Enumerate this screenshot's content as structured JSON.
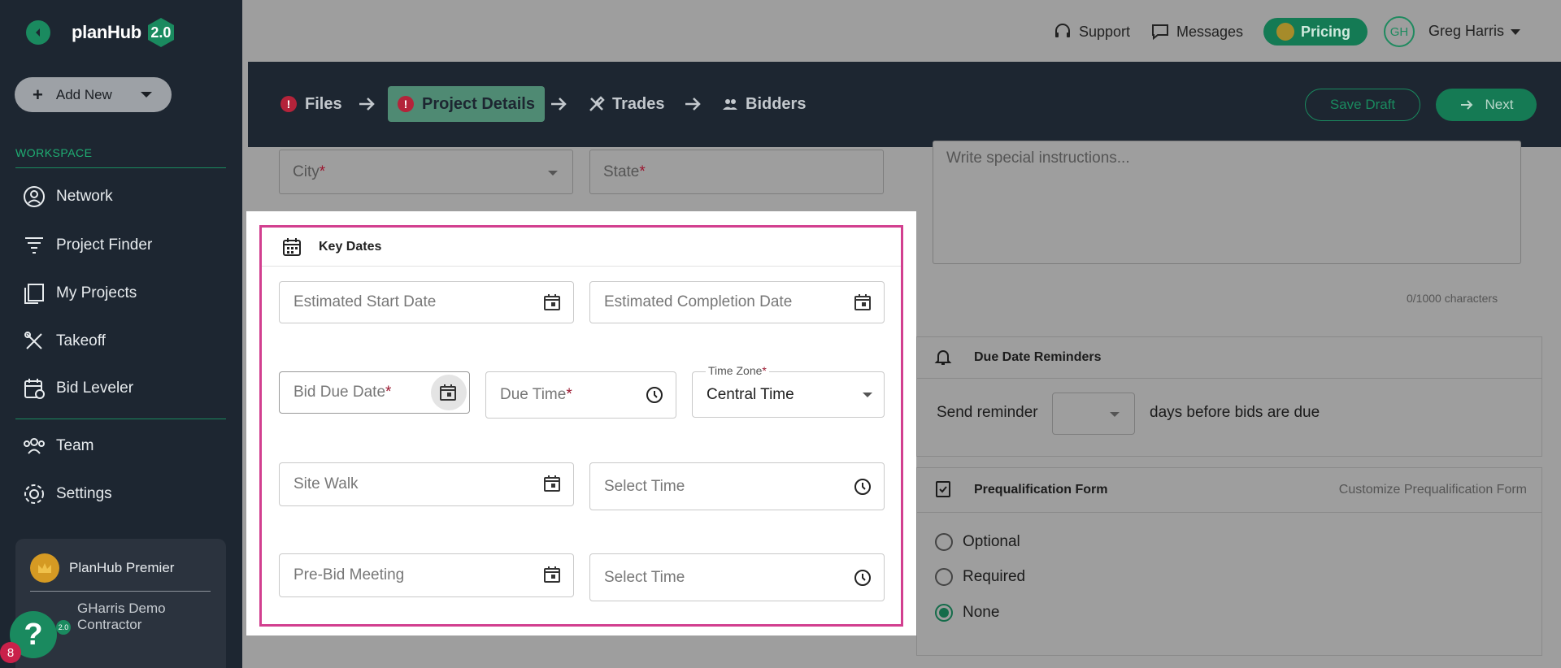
{
  "brand": {
    "name": "planHub",
    "version": "2.0"
  },
  "sidebar": {
    "add_new": "Add New",
    "workspace_label": "WORKSPACE",
    "items": [
      {
        "label": "Network",
        "icon": "user-circle-icon"
      },
      {
        "label": "Project Finder",
        "icon": "filter-icon"
      },
      {
        "label": "My Projects",
        "icon": "projects-icon"
      },
      {
        "label": "Takeoff",
        "icon": "takeoff-icon"
      },
      {
        "label": "Bid Leveler",
        "icon": "bid-leveler-icon"
      },
      {
        "label": "Team",
        "icon": "team-icon"
      },
      {
        "label": "Settings",
        "icon": "gear-icon"
      }
    ],
    "premier": {
      "label": "PlanHub Premier",
      "company": "GHarris Demo Contractor",
      "badge": "2.0"
    },
    "help_badge": "8"
  },
  "topbar": {
    "support": "Support",
    "messages": "Messages",
    "pricing": "Pricing",
    "avatar": "GH",
    "user": "Greg Harris"
  },
  "steps": [
    {
      "label": "Files",
      "warn": "!"
    },
    {
      "label": "Project Details",
      "warn": "!"
    },
    {
      "label": "Trades"
    },
    {
      "label": "Bidders"
    }
  ],
  "actions": {
    "save_draft": "Save Draft",
    "next": "Next"
  },
  "background_form": {
    "city": "City",
    "state": "State",
    "instructions_placeholder": "Write special instructions...",
    "char_count": "0/1000 characters",
    "reminders_title": "Due Date Reminders",
    "send_reminder": "Send reminder",
    "days_before": "days before bids are due",
    "prequal_title": "Prequalification Form",
    "customize_prequal": "Customize Prequalification Form",
    "options": [
      "Optional",
      "Required",
      "None"
    ],
    "selected_option": "None"
  },
  "key_dates": {
    "title": "Key Dates",
    "est_start": "Estimated Start Date",
    "est_completion": "Estimated Completion Date",
    "bid_due": "Bid Due Date",
    "due_time": "Due Time",
    "tz_label": "Time Zone",
    "tz_value": "Central Time",
    "site_walk": "Site Walk",
    "select_time": "Select Time",
    "pre_bid": "Pre-Bid Meeting",
    "required_mark": "*"
  },
  "colors": {
    "accent": "#1a8a5f",
    "highlight": "#d23f8f",
    "sidebar": "#1d2631"
  }
}
